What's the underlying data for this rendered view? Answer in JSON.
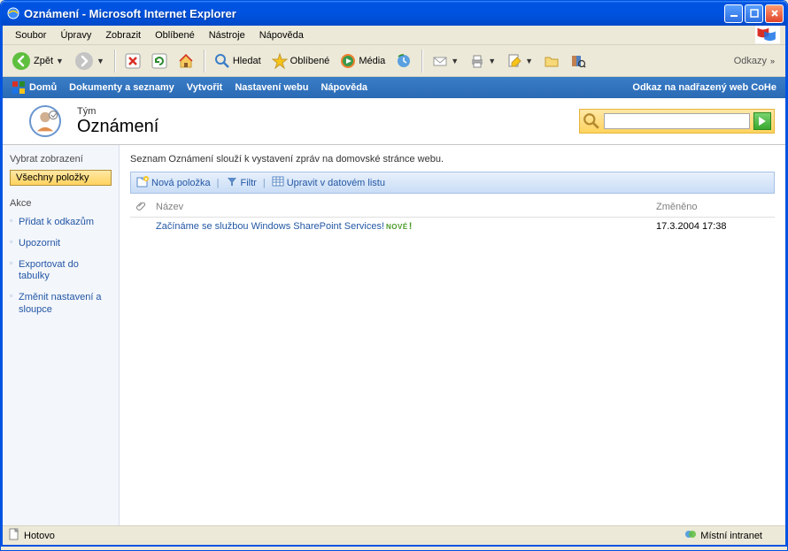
{
  "window": {
    "title": "Oznámení - Microsoft Internet Explorer"
  },
  "menubar": {
    "items": [
      "Soubor",
      "Úpravy",
      "Zobrazit",
      "Oblíbené",
      "Nástroje",
      "Nápověda"
    ]
  },
  "toolbar": {
    "back": "Zpět",
    "search": "Hledat",
    "favorites": "Oblíbené",
    "media": "Média",
    "links": "Odkazy"
  },
  "sp_nav": {
    "home": "Domů",
    "documents": "Dokumenty a seznamy",
    "create": "Vytvořit",
    "settings": "Nastavení webu",
    "help": "Nápověda",
    "parent_link": "Odkaz na nadřazený web CoHe"
  },
  "header": {
    "breadcrumb": "Tým",
    "title": "Oznámení",
    "search_placeholder": ""
  },
  "sidebar": {
    "view_label": "Vybrat zobrazení",
    "selected_view": "Všechny položky",
    "actions_label": "Akce",
    "actions": [
      "Přidat k odkazům",
      "Upozornit",
      "Exportovat do tabulky",
      "Změnit nastavení a sloupce"
    ]
  },
  "content": {
    "description": "Seznam Oznámení slouží k vystavení zpráv na domovské stránce webu.",
    "list_toolbar": {
      "new_item": "Nová položka",
      "filter": "Filtr",
      "datasheet": "Upravit v datovém listu"
    },
    "columns": {
      "attach": "",
      "name": "Název",
      "modified": "Změněno"
    },
    "rows": [
      {
        "title": "Začínáme se službou Windows SharePoint Services!",
        "new_badge": "NOVÉ",
        "modified": "17.3.2004 17:38"
      }
    ]
  },
  "statusbar": {
    "left": "Hotovo",
    "zone": "Místní intranet"
  }
}
